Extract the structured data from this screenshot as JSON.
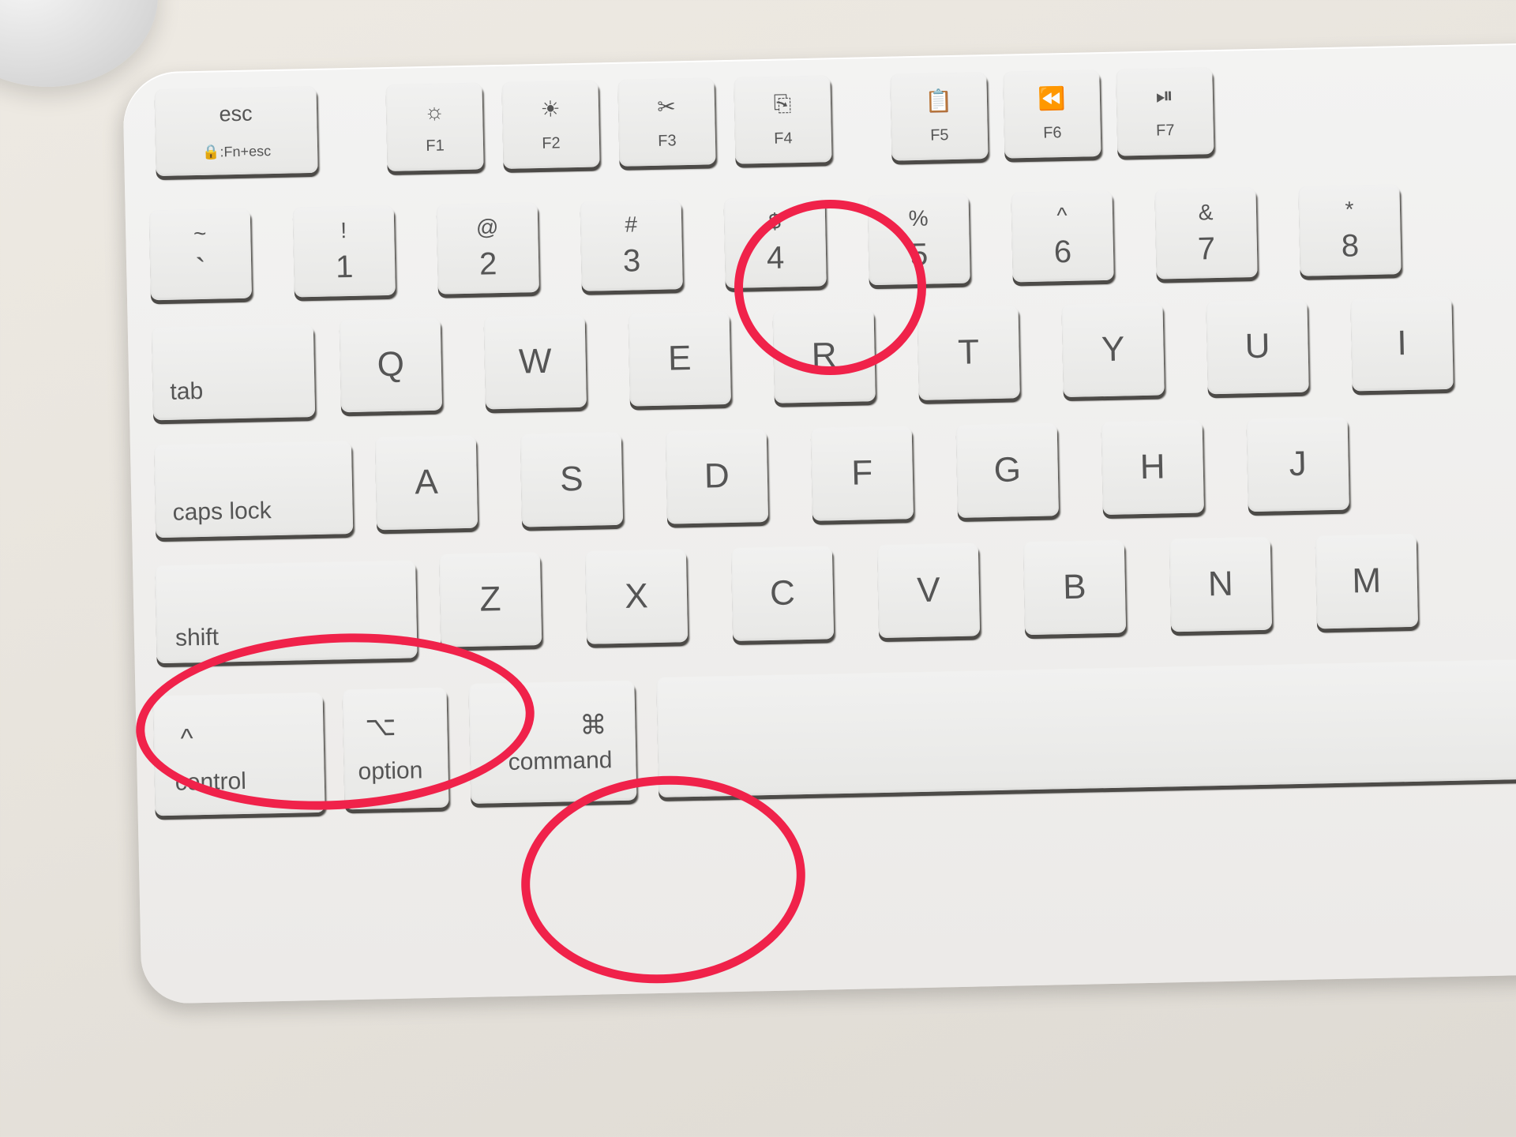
{
  "scene": {
    "description": "Photo of a white Apple Magic Keyboard with three keys circled in red",
    "annotation_color": "#f0224a",
    "highlighted_keys": [
      "4",
      "shift",
      "command"
    ]
  },
  "keys": {
    "esc": {
      "label": "esc",
      "sub": "🔒:Fn+esc"
    },
    "f1": {
      "icon": "☼",
      "label": "F1"
    },
    "f2": {
      "icon": "☀",
      "label": "F2"
    },
    "f3": {
      "icon": "✂",
      "label": "F3"
    },
    "f4": {
      "icon": "⎘",
      "label": "F4"
    },
    "f5": {
      "icon": "📋",
      "label": "F5"
    },
    "f6": {
      "icon": "⏪",
      "label": "F6"
    },
    "f7": {
      "icon": "⏯",
      "label": "F7"
    },
    "number_row": [
      {
        "top": "~",
        "bottom": "`"
      },
      {
        "top": "!",
        "bottom": "1"
      },
      {
        "top": "@",
        "bottom": "2"
      },
      {
        "top": "#",
        "bottom": "3"
      },
      {
        "top": "$",
        "bottom": "4"
      },
      {
        "top": "%",
        "bottom": "5"
      },
      {
        "top": "^",
        "bottom": "6"
      },
      {
        "top": "&",
        "bottom": "7"
      },
      {
        "top": "*",
        "bottom": "8"
      }
    ],
    "tab": "tab",
    "qwerty_row": [
      "Q",
      "W",
      "E",
      "R",
      "T",
      "Y",
      "U",
      "I"
    ],
    "caps_lock": "caps lock",
    "asdf_row": [
      "A",
      "S",
      "D",
      "F",
      "G",
      "H",
      "J"
    ],
    "shift": "shift",
    "zxcv_row": [
      "Z",
      "X",
      "C",
      "V",
      "B",
      "N",
      "M"
    ],
    "control": {
      "symbol": "^",
      "label": "control"
    },
    "option": {
      "symbol": "⌥",
      "label": "option"
    },
    "command": {
      "symbol": "⌘",
      "label": "command"
    }
  }
}
